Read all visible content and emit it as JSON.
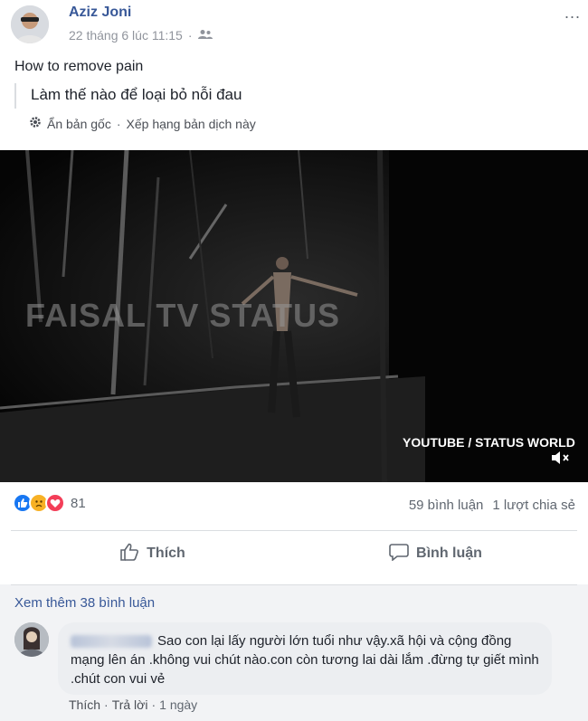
{
  "post": {
    "author": "Aziz Joni",
    "timestamp": "22 tháng 6 lúc 11:15",
    "privacy_icon": "friends-icon",
    "more_label": "...",
    "text": "How to remove pain",
    "translation": "Làm thế nào để loại bỏ nỗi đau",
    "see_original": "Ẩn bản gốc",
    "rate_translation": "Xếp hạng bản dịch này",
    "separator": "·"
  },
  "video": {
    "watermark_main": "FAISAL TV STATUS",
    "watermark_corner": "YOUTUBE / STATUS WORLD"
  },
  "engagement": {
    "reaction_count": "81",
    "comments": "59 bình luận",
    "shares": "1 lượt chia sẻ"
  },
  "actions": {
    "like": "Thích",
    "comment": "Bình luận"
  },
  "comments": {
    "view_more": "Xem thêm 38 bình luận",
    "item": {
      "text": "Sao con lại lấy người lớn tuổi như vậy.xã hội và cộng đồng mạng lên án .không vui chút nào.con còn tương lai dài lắm .đừng tự giết mình .chút con vui vẻ",
      "like": "Thích",
      "reply": "Trả lời",
      "time": "1 ngày",
      "separator": "·"
    }
  },
  "colors": {
    "link_blue": "#385898",
    "like_blue": "#1877f2",
    "love_red": "#f33e58",
    "sad_yellow": "#f7b125"
  }
}
